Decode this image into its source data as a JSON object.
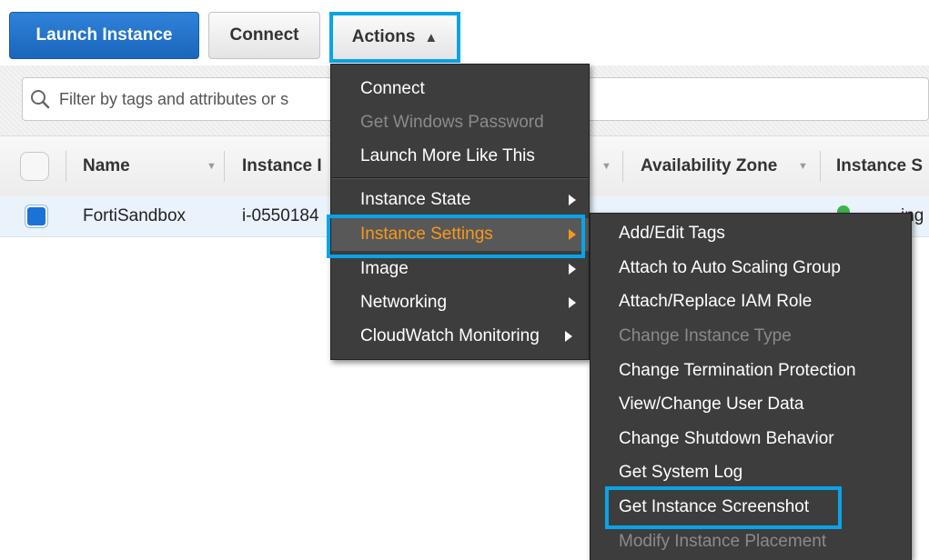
{
  "toolbar": {
    "launch_label": "Launch Instance",
    "connect_label": "Connect",
    "actions_label": "Actions"
  },
  "search": {
    "placeholder": "Filter by tags and attributes or s"
  },
  "table": {
    "columns": [
      "Name",
      "Instance I",
      "Availability Zone",
      "Instance S"
    ],
    "row": {
      "name": "FortiSandbox",
      "instance_id": "i-0550184",
      "state_fragment": "ing"
    }
  },
  "actions_menu": {
    "items": [
      {
        "label": "Connect"
      },
      {
        "label": "Get Windows Password"
      },
      {
        "label": "Launch More Like This"
      },
      {
        "label": "Instance State"
      },
      {
        "label": "Instance Settings"
      },
      {
        "label": "Image"
      },
      {
        "label": "Networking"
      },
      {
        "label": "CloudWatch Monitoring"
      }
    ]
  },
  "settings_submenu": {
    "items": [
      {
        "label": "Add/Edit Tags"
      },
      {
        "label": "Attach to Auto Scaling Group"
      },
      {
        "label": "Attach/Replace IAM Role"
      },
      {
        "label": "Change Instance Type"
      },
      {
        "label": "Change Termination Protection"
      },
      {
        "label": "View/Change User Data"
      },
      {
        "label": "Change Shutdown Behavior"
      },
      {
        "label": "Get System Log"
      },
      {
        "label": "Get Instance Screenshot"
      },
      {
        "label": "Modify Instance Placement"
      }
    ]
  },
  "colors": {
    "primary": "#1a66bd",
    "highlight": "#0aa3e8",
    "menu_bg": "#3d3d3d",
    "menu_active": "#f7981d"
  }
}
